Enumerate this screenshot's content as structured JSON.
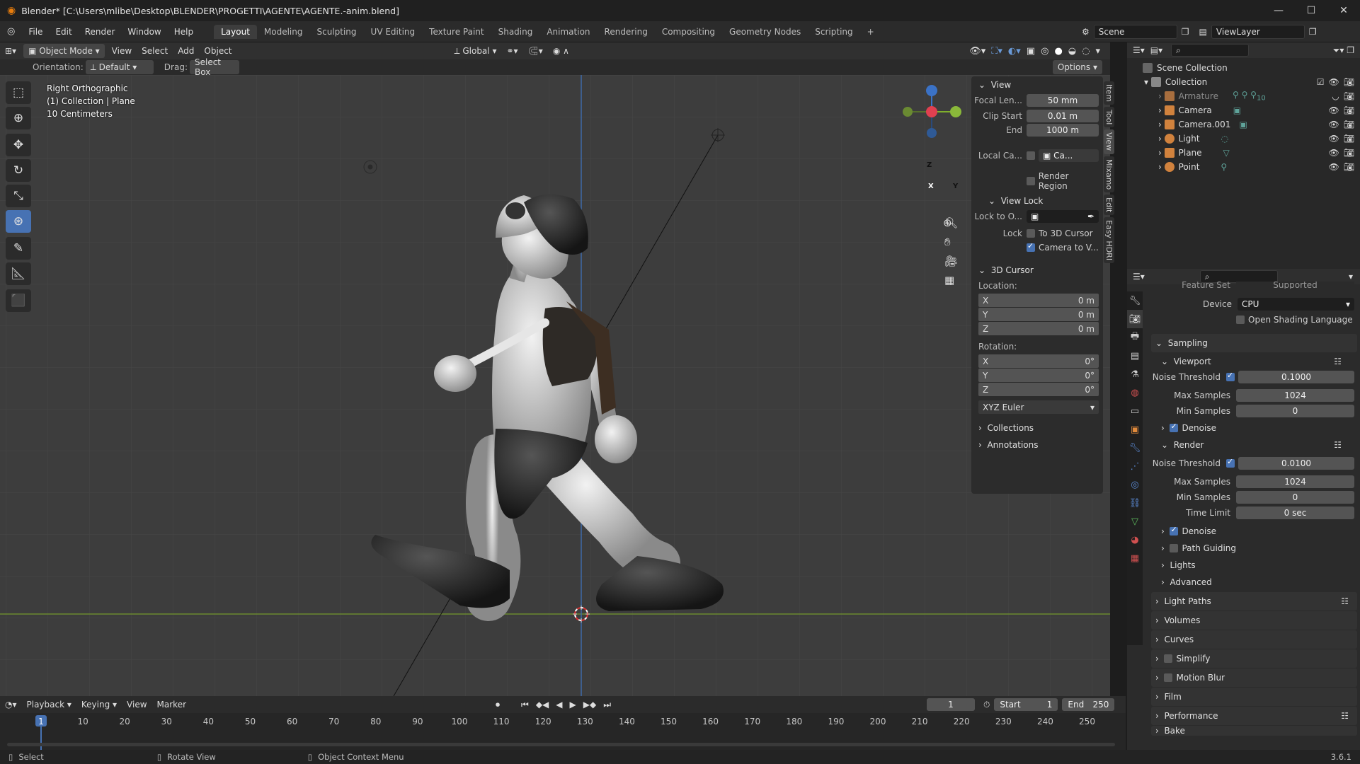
{
  "window": {
    "title": "Blender* [C:\\Users\\mlibe\\Desktop\\BLENDER\\PROGETTI\\AGENTE\\AGENTE.-anim.blend]"
  },
  "menu": [
    "File",
    "Edit",
    "Render",
    "Window",
    "Help"
  ],
  "workspaces": [
    "Layout",
    "Modeling",
    "Sculpting",
    "UV Editing",
    "Texture Paint",
    "Shading",
    "Animation",
    "Rendering",
    "Compositing",
    "Geometry Nodes",
    "Scripting"
  ],
  "scene": {
    "name": "Scene",
    "view_layer": "ViewLayer"
  },
  "viewport_header": {
    "mode": "Object Mode",
    "menus": [
      "View",
      "Select",
      "Add",
      "Object"
    ],
    "transform": "Global"
  },
  "tool_header": {
    "orientation_label": "Orientation:",
    "orientation": "Default",
    "drag_label": "Drag:",
    "drag": "Select Box",
    "options": "Options"
  },
  "viewport_info": {
    "line1": "Right Orthographic",
    "line2": "(1) Collection | Plane",
    "line3": "10 Centimeters"
  },
  "gizmo": {
    "z": "Z",
    "y": "Y",
    "x": "X"
  },
  "npanel": {
    "view_title": "View",
    "focal_label": "Focal Len...",
    "focal": "50 mm",
    "clip_start_label": "Clip Start",
    "clip_start": "0.01 m",
    "end_label": "End",
    "end": "1000 m",
    "local_cam_label": "Local Ca...",
    "local_cam_value": "Ca...",
    "render_region": "Render Region",
    "view_lock_title": "View Lock",
    "lock_to_label": "Lock to O...",
    "lock_label": "Lock",
    "to_3d_cursor": "To 3D Cursor",
    "camera_to_view": "Camera to V...",
    "cursor_title": "3D Cursor",
    "location_label": "Location:",
    "loc": [
      {
        "axis": "X",
        "value": "0 m"
      },
      {
        "axis": "Y",
        "value": "0 m"
      },
      {
        "axis": "Z",
        "value": "0 m"
      }
    ],
    "rotation_label": "Rotation:",
    "rot": [
      {
        "axis": "X",
        "value": "0°"
      },
      {
        "axis": "Y",
        "value": "0°"
      },
      {
        "axis": "Z",
        "value": "0°"
      }
    ],
    "rot_mode": "XYZ Euler",
    "collections": "Collections",
    "annotations": "Annotations",
    "side_tabs": [
      "Item",
      "Tool",
      "View",
      "Mixamo",
      "Edit",
      "Easy HDRI"
    ]
  },
  "outliner": {
    "scene_collection": "Scene Collection",
    "collection": "Collection",
    "items": [
      {
        "name": "Armature",
        "color": "#c68a4a"
      },
      {
        "name": "Camera",
        "color": "#d1823d"
      },
      {
        "name": "Camera.001",
        "color": "#d1823d"
      },
      {
        "name": "Light",
        "color": "#d1823d"
      },
      {
        "name": "Plane",
        "color": "#d1823d"
      },
      {
        "name": "Point",
        "color": "#d1823d"
      }
    ],
    "armature_badge": "10"
  },
  "properties": {
    "feature_set_label": "Feature Set",
    "feature_set": "Supported",
    "device_label": "Device",
    "device": "CPU",
    "osl": "Open Shading Language",
    "sampling": "Sampling",
    "viewport": "Viewport",
    "noise_threshold_label": "Noise Threshold",
    "viewport_noise": "0.1000",
    "max_samples_label": "Max Samples",
    "viewport_max": "1024",
    "min_samples_label": "Min Samples",
    "viewport_min": "0",
    "denoise": "Denoise",
    "render": "Render",
    "render_noise": "0.0100",
    "render_max": "1024",
    "render_min": "0",
    "time_limit_label": "Time Limit",
    "time_limit": "0 sec",
    "path_guiding": "Path Guiding",
    "lights": "Lights",
    "advanced": "Advanced",
    "sections": [
      "Light Paths",
      "Volumes",
      "Curves",
      "Simplify",
      "Motion Blur",
      "Film",
      "Performance",
      "Bake"
    ]
  },
  "timeline": {
    "menus": [
      "Playback",
      "Keying",
      "View",
      "Marker"
    ],
    "current_frame": "1",
    "start_label": "Start",
    "start": "1",
    "end_label": "End",
    "end": "250",
    "ticks": [
      "1",
      "10",
      "20",
      "30",
      "40",
      "50",
      "60",
      "70",
      "80",
      "90",
      "100",
      "110",
      "120",
      "130",
      "140",
      "150",
      "160",
      "170",
      "180",
      "190",
      "200",
      "210",
      "220",
      "230",
      "240",
      "250"
    ]
  },
  "statusbar": {
    "select": "Select",
    "rotate": "Rotate View",
    "context": "Object Context Menu",
    "version": "3.6.1"
  }
}
